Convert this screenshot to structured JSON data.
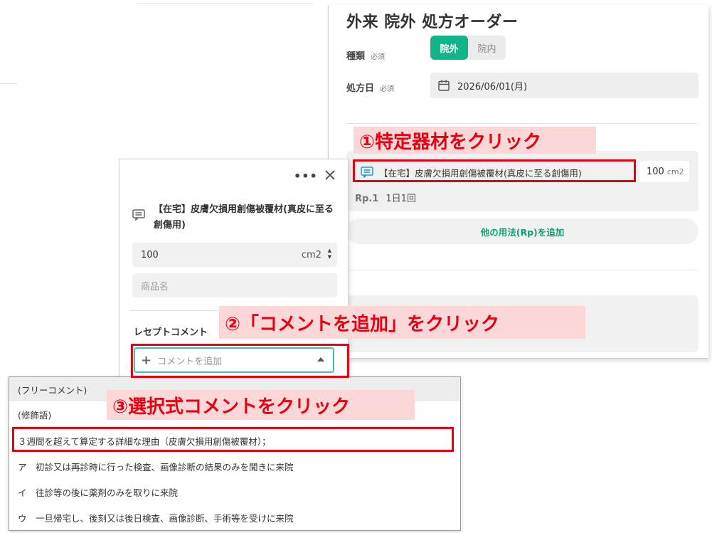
{
  "order": {
    "title": "外来 院外 処方オーダー",
    "type_label": "種類",
    "required": "必須",
    "type_options": [
      "院外",
      "院内"
    ],
    "date_label": "処方日",
    "date_value": "2026/06/01(月)",
    "rx_item_name": "【在宅】皮膚欠損用創傷被覆材(真皮に至る創傷用)",
    "rx_qty": "100",
    "rx_unit": "cm2",
    "rp_label": "Rp.1",
    "rp_usage": "1日1回",
    "add_rp_label": "他の用法(Rp)を追加"
  },
  "detail": {
    "item_name": "【在宅】皮膚欠損用創傷被覆材(真皮に至る創傷用)",
    "qty": "100",
    "unit": "cm2",
    "product_placeholder": "商品名",
    "section_label": "レセプトコメント",
    "comment_placeholder": "コメントを追加"
  },
  "dropdown": {
    "items": [
      "(フリーコメント)",
      "(修飾語)",
      "３週間を超えて算定する詳細な理由（皮膚欠損用創傷被覆材）；",
      "ア　初診又は再診時に行った検査、画像診断の結果のみを聞きに来院",
      "イ　往診等の後に薬剤のみを取りに来院",
      "ウ　一旦帰宅し、後刻又は後日検査、画像診断、手術等を受けに来院"
    ]
  },
  "annotations": {
    "step1": "①特定器材をクリック",
    "step2": "②「コメントを追加」をクリック",
    "step3": "③選択式コメントをクリック"
  },
  "colors": {
    "accent_green": "#12b58a",
    "annotation_red": "#e60012",
    "annotation_bg": "#fbd7d7"
  },
  "icons": {
    "calendar": "calendar-icon",
    "material": "material-list-icon",
    "close": "close-icon",
    "more": "more-icon",
    "plus": "plus-icon",
    "caret": "caret-up-icon"
  }
}
